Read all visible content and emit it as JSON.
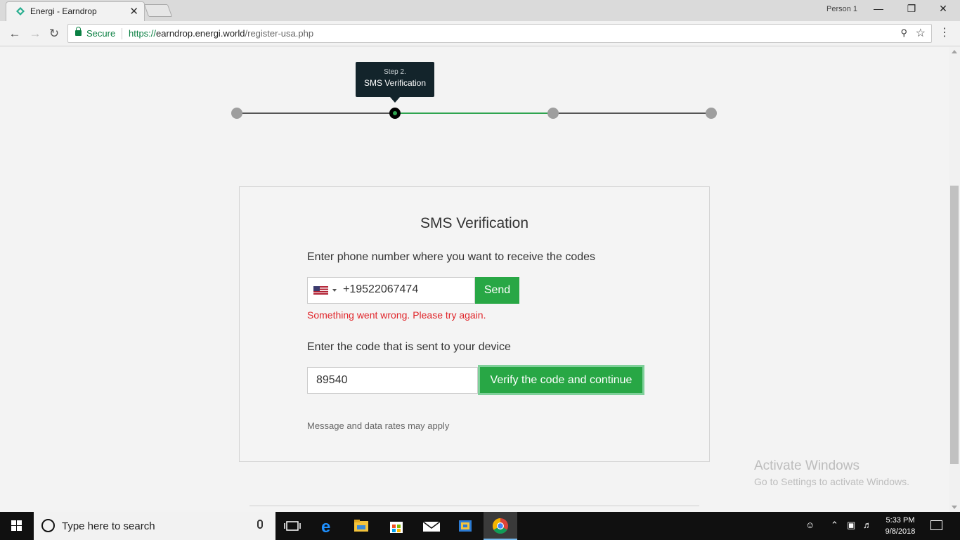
{
  "browser": {
    "tab_title": "Energi - Earndrop",
    "tab_close": "✕",
    "profile": "Person 1",
    "secure_label": "Secure",
    "url_scheme": "https://",
    "url_host": "earndrop.energi.world",
    "url_path": "/register-usa.php"
  },
  "stepper": {
    "tooltip_step": "Step 2.",
    "tooltip_label": "SMS Verification",
    "current_step": 2,
    "total_steps": 4
  },
  "form": {
    "title": "SMS Verification",
    "phone_prompt": "Enter phone number where you want to receive the codes",
    "phone_value": "+19522067474",
    "country": "US",
    "send_label": "Send",
    "error_text": "Something went wrong. Please try again.",
    "code_prompt": "Enter the code that is sent to your device",
    "code_value": "89540",
    "verify_label": "Verify the code and continue",
    "note": "Message and data rates may apply"
  },
  "watermark": {
    "line1": "Activate Windows",
    "line2": "Go to Settings to activate Windows."
  },
  "taskbar": {
    "search_placeholder": "Type here to search",
    "time": "5:33 PM",
    "date": "9/8/2018"
  },
  "colors": {
    "accent_green": "#28a745",
    "error_red": "#e0262b",
    "tooltip_bg": "#13242b"
  }
}
